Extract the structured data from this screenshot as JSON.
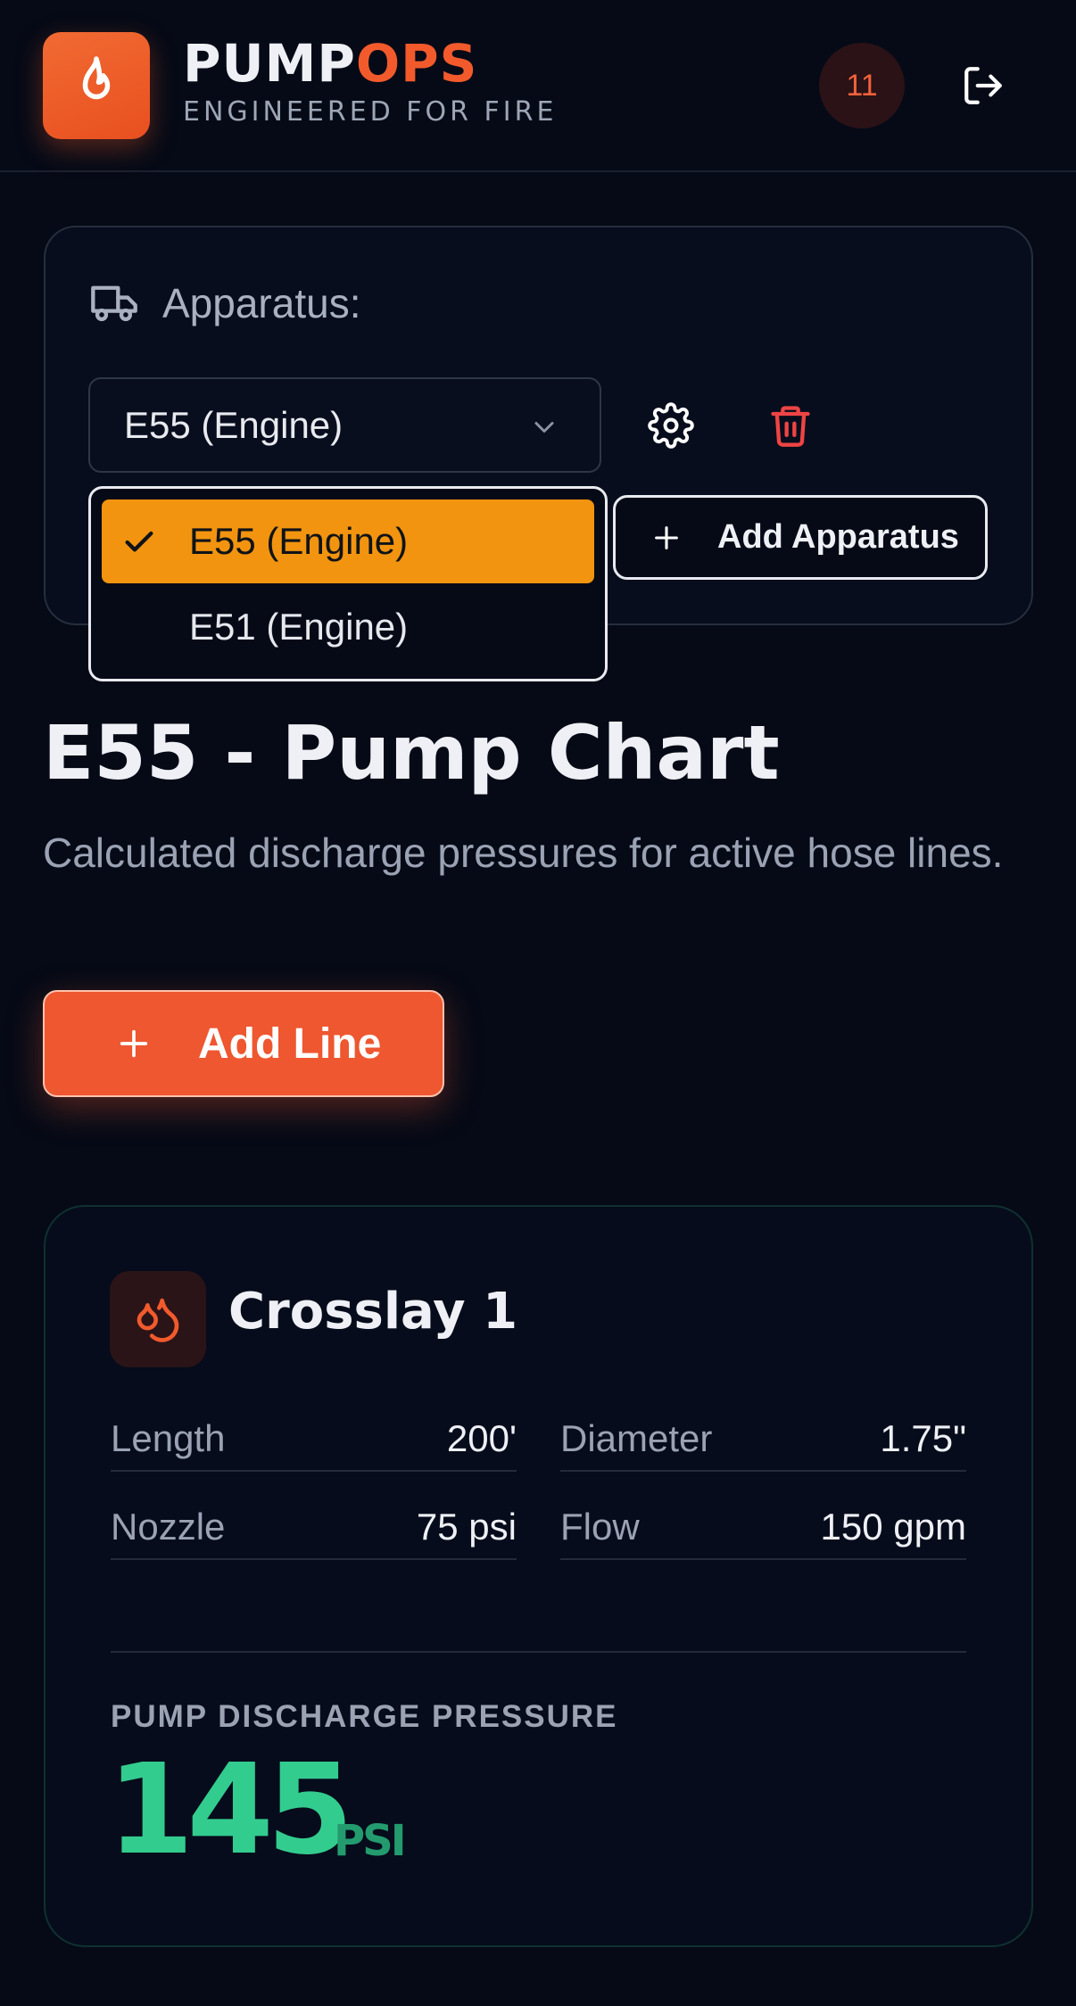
{
  "header": {
    "brand_part1": "PUMP",
    "brand_part2": "OPS",
    "tagline": "ENGINEERED FOR FIRE",
    "badge_count": "11",
    "logo_icon": "flame-icon",
    "logout_icon": "logout-icon"
  },
  "apparatus": {
    "label": "Apparatus:",
    "selected": "E55 (Engine)",
    "options": [
      "E55 (Engine)",
      "E51 (Engine)"
    ],
    "add_button_label": "Add Apparatus"
  },
  "page": {
    "title": "E55 - Pump Chart",
    "subtitle": "Calculated discharge pressures for active hose lines.",
    "add_line_label": "Add Line"
  },
  "lines": [
    {
      "name": "Crosslay 1",
      "length_label": "Length",
      "length": "200'",
      "diameter_label": "Diameter",
      "diameter": "1.75\"",
      "nozzle_label": "Nozzle",
      "nozzle": "75 psi",
      "flow_label": "Flow",
      "flow": "150 gpm",
      "pdp_label": "PUMP DISCHARGE PRESSURE",
      "pdp_value": "145",
      "pdp_unit": "PSI"
    }
  ],
  "colors": {
    "background": "#050a16",
    "accent": "#ee5730",
    "selected_option": "#f2940f",
    "pressure": "#33cc8f",
    "danger": "#ef4444"
  }
}
